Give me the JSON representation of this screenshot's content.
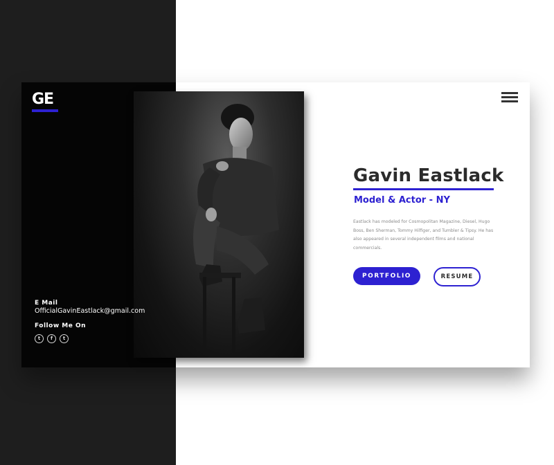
{
  "brand": {
    "logo_text": "GE",
    "accent_color": "#2d21d1"
  },
  "contact": {
    "email_label": "E Mail",
    "email": "OfficialGavinEastlack@gmail.com",
    "follow_label": "Follow Me On",
    "socials": [
      {
        "name": "twitter-icon",
        "glyph": "t"
      },
      {
        "name": "facebook-icon",
        "glyph": "f"
      },
      {
        "name": "twitter-icon",
        "glyph": "t"
      }
    ]
  },
  "hero": {
    "name": "Gavin Eastlack",
    "role": "Model & Actor - NY",
    "bio": "Eastlack has modeled for Cosmopolitan Magazine, Diesel, Hugo Boss, Ben Sherman, Tommy Hilfiger, and Tumbler & Tipsy. He has also appeared in several independent films and national commercials."
  },
  "buttons": {
    "portfolio": "PORTFOLIO",
    "resume": "RESUME"
  }
}
